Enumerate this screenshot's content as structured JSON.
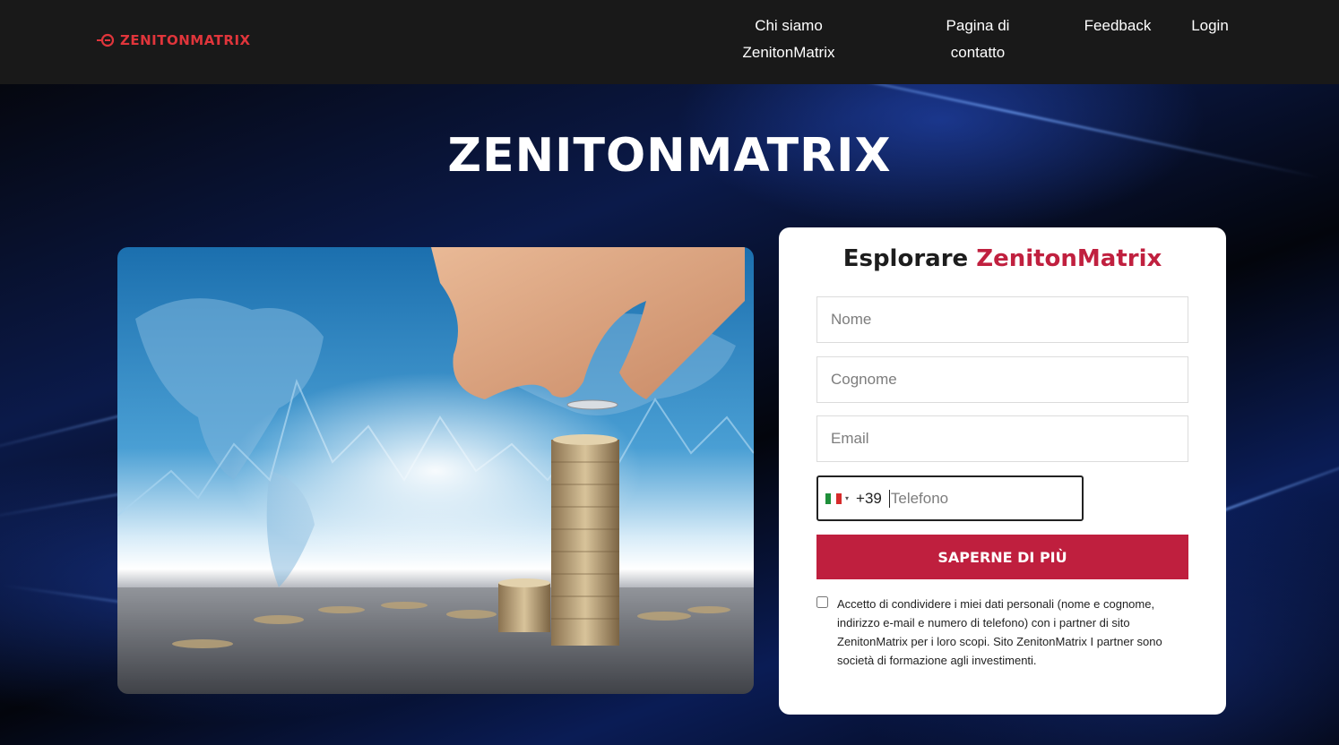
{
  "header": {
    "logo_text": "ZENITONMATRIX",
    "nav": [
      {
        "label_line1": "Chi siamo",
        "label_line2": "ZenitonMatrix"
      },
      {
        "label_line1": "Pagina di",
        "label_line2": "contatto"
      },
      {
        "label_line1": "Feedback"
      },
      {
        "label_line1": "Login"
      }
    ]
  },
  "hero": {
    "title": "ZENITONMATRIX"
  },
  "form": {
    "title_plain": "Esplorare",
    "title_accent": "ZenitonMatrix",
    "nome_placeholder": "Nome",
    "cognome_placeholder": "Cognome",
    "email_placeholder": "Email",
    "phone_dial_code": "+39",
    "phone_placeholder": "Telefono",
    "phone_country_flag": "italy-flag",
    "submit_label": "SAPERNE DI PIÙ",
    "consent_text": "Accetto di condividere i miei dati personali (nome e cognome, indirizzo e-mail e numero di telefono) con i partner di sito ZenitonMatrix per i loro scopi. Sito ZenitonMatrix I partner sono società di formazione agli investimenti."
  },
  "colors": {
    "header_bg": "#191919",
    "logo": "#e0353b",
    "accent": "#bf1f3e",
    "hero_bg": "#0b1a4a"
  }
}
